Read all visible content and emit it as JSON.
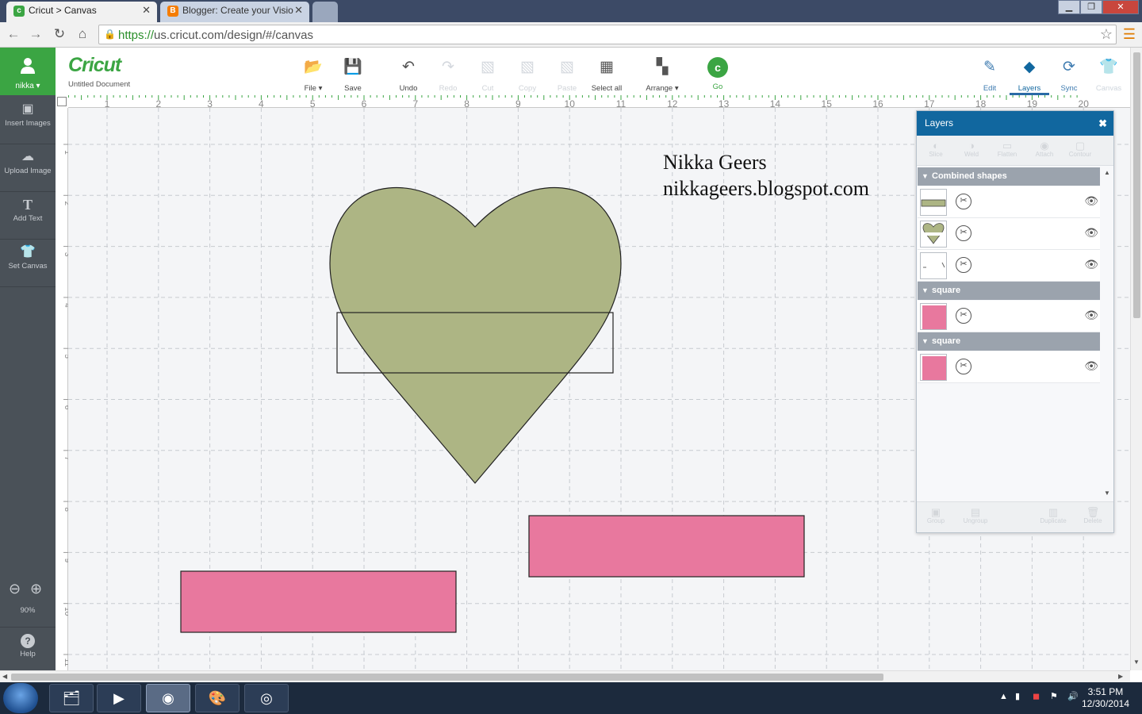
{
  "browser": {
    "tabs": [
      {
        "title": "Cricut > Canvas",
        "active": true
      },
      {
        "title": "Blogger: Create your Visio",
        "active": false
      }
    ],
    "url_scheme": "https://",
    "url_rest": "us.cricut.com/design/#/canvas"
  },
  "sidebar": {
    "user": "nikka",
    "items": [
      {
        "label": "Insert Images",
        "icon": "image-icon"
      },
      {
        "label": "Upload Image",
        "icon": "upload-cloud-icon"
      },
      {
        "label": "Add Text",
        "icon": "text-icon"
      },
      {
        "label": "Set Canvas",
        "icon": "shirt-icon"
      }
    ],
    "zoom": "90%",
    "help": "Help"
  },
  "appbar": {
    "logo": "Cricut",
    "document": "Untitled Document",
    "buttons": [
      {
        "label": "File",
        "icon": "folder-icon",
        "enabled": true
      },
      {
        "label": "Save",
        "icon": "save-icon",
        "enabled": true
      },
      {
        "label": "Undo",
        "icon": "undo-icon",
        "enabled": true
      },
      {
        "label": "Redo",
        "icon": "redo-icon",
        "enabled": false
      },
      {
        "label": "Cut",
        "icon": "cut-icon",
        "enabled": false
      },
      {
        "label": "Copy",
        "icon": "copy-icon",
        "enabled": false
      },
      {
        "label": "Paste",
        "icon": "paste-icon",
        "enabled": false
      },
      {
        "label": "Select all",
        "icon": "select-all-icon",
        "enabled": true
      },
      {
        "label": "Arrange",
        "icon": "arrange-icon",
        "enabled": true
      },
      {
        "label": "Go",
        "icon": "go-icon",
        "enabled": true
      }
    ],
    "right_buttons": [
      {
        "label": "Edit",
        "icon": "edit-icon",
        "enabled": true,
        "selected": false
      },
      {
        "label": "Layers",
        "icon": "layers-icon",
        "enabled": true,
        "selected": true
      },
      {
        "label": "Sync",
        "icon": "sync-icon",
        "enabled": true,
        "selected": false
      },
      {
        "label": "Canvas",
        "icon": "canvas-shirt-icon",
        "enabled": false,
        "selected": false
      }
    ]
  },
  "canvas": {
    "ruler_top": [
      "1",
      "2",
      "3",
      "4",
      "5",
      "6",
      "7",
      "8",
      "9",
      "10",
      "11",
      "12",
      "13",
      "14",
      "15",
      "16",
      "17",
      "18",
      "19",
      "20"
    ],
    "ruler_left": [
      "1",
      "2",
      "3",
      "4",
      "5",
      "6",
      "7",
      "8",
      "9",
      "10",
      "11"
    ],
    "text_lines": [
      "Nikka Geers",
      "nikkageers.blogspot.com"
    ],
    "colors": {
      "heart": "#adb584",
      "band": "#adb584",
      "pink": "#e8789e",
      "grid": "#c7cbd0"
    }
  },
  "layers": {
    "title": "Layers",
    "tools": [
      "Slice",
      "Weld",
      "Flatten",
      "Attach",
      "Contour"
    ],
    "footer_tools": [
      "Group",
      "Ungroup",
      "Duplicate",
      "Delete"
    ],
    "groups": [
      {
        "name": "Combined shapes",
        "rows": [
          {
            "thumb": "band"
          },
          {
            "thumb": "heart"
          },
          {
            "thumb": "corners"
          }
        ]
      },
      {
        "name": "square",
        "rows": [
          {
            "thumb": "pink"
          }
        ]
      },
      {
        "name": "square",
        "rows": [
          {
            "thumb": "pink"
          }
        ]
      }
    ]
  },
  "taskbar": {
    "time": "3:51 PM",
    "date": "12/30/2014"
  }
}
